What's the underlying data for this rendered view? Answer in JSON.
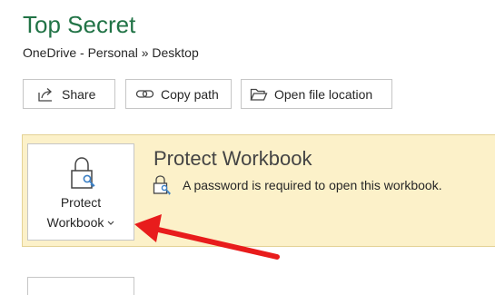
{
  "header": {
    "title": "Top Secret",
    "path": "OneDrive - Personal » Desktop"
  },
  "actions": {
    "share_label": "Share",
    "copy_path_label": "Copy path",
    "open_location_label": "Open file location"
  },
  "protect": {
    "button_line1": "Protect",
    "button_line2": "Workbook",
    "heading": "Protect Workbook",
    "status": "A password is required to open this workbook."
  },
  "icons": {
    "share": "share-icon",
    "copy_path": "link-icon",
    "open_location": "folder-open-icon",
    "protect": "lock-key-icon",
    "status": "lock-key-icon",
    "dropdown": "chevron-down-icon",
    "annotation": "red-arrow"
  },
  "colors": {
    "title": "#217346",
    "panel_background": "#fcf1c9",
    "panel_border": "#e4d295",
    "arrow": "#e81c1c"
  }
}
